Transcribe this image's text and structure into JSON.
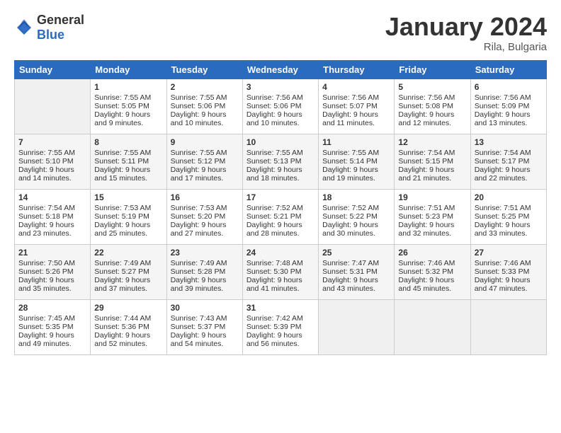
{
  "logo": {
    "text_general": "General",
    "text_blue": "Blue"
  },
  "title": "January 2024",
  "location": "Rila, Bulgaria",
  "days_header": [
    "Sunday",
    "Monday",
    "Tuesday",
    "Wednesday",
    "Thursday",
    "Friday",
    "Saturday"
  ],
  "weeks": [
    [
      {
        "num": "",
        "empty": true
      },
      {
        "num": "1",
        "sunrise": "Sunrise: 7:55 AM",
        "sunset": "Sunset: 5:05 PM",
        "daylight": "Daylight: 9 hours and 9 minutes."
      },
      {
        "num": "2",
        "sunrise": "Sunrise: 7:55 AM",
        "sunset": "Sunset: 5:06 PM",
        "daylight": "Daylight: 9 hours and 10 minutes."
      },
      {
        "num": "3",
        "sunrise": "Sunrise: 7:56 AM",
        "sunset": "Sunset: 5:06 PM",
        "daylight": "Daylight: 9 hours and 10 minutes."
      },
      {
        "num": "4",
        "sunrise": "Sunrise: 7:56 AM",
        "sunset": "Sunset: 5:07 PM",
        "daylight": "Daylight: 9 hours and 11 minutes."
      },
      {
        "num": "5",
        "sunrise": "Sunrise: 7:56 AM",
        "sunset": "Sunset: 5:08 PM",
        "daylight": "Daylight: 9 hours and 12 minutes."
      },
      {
        "num": "6",
        "sunrise": "Sunrise: 7:56 AM",
        "sunset": "Sunset: 5:09 PM",
        "daylight": "Daylight: 9 hours and 13 minutes."
      }
    ],
    [
      {
        "num": "7",
        "sunrise": "Sunrise: 7:55 AM",
        "sunset": "Sunset: 5:10 PM",
        "daylight": "Daylight: 9 hours and 14 minutes."
      },
      {
        "num": "8",
        "sunrise": "Sunrise: 7:55 AM",
        "sunset": "Sunset: 5:11 PM",
        "daylight": "Daylight: 9 hours and 15 minutes."
      },
      {
        "num": "9",
        "sunrise": "Sunrise: 7:55 AM",
        "sunset": "Sunset: 5:12 PM",
        "daylight": "Daylight: 9 hours and 17 minutes."
      },
      {
        "num": "10",
        "sunrise": "Sunrise: 7:55 AM",
        "sunset": "Sunset: 5:13 PM",
        "daylight": "Daylight: 9 hours and 18 minutes."
      },
      {
        "num": "11",
        "sunrise": "Sunrise: 7:55 AM",
        "sunset": "Sunset: 5:14 PM",
        "daylight": "Daylight: 9 hours and 19 minutes."
      },
      {
        "num": "12",
        "sunrise": "Sunrise: 7:54 AM",
        "sunset": "Sunset: 5:15 PM",
        "daylight": "Daylight: 9 hours and 21 minutes."
      },
      {
        "num": "13",
        "sunrise": "Sunrise: 7:54 AM",
        "sunset": "Sunset: 5:17 PM",
        "daylight": "Daylight: 9 hours and 22 minutes."
      }
    ],
    [
      {
        "num": "14",
        "sunrise": "Sunrise: 7:54 AM",
        "sunset": "Sunset: 5:18 PM",
        "daylight": "Daylight: 9 hours and 23 minutes."
      },
      {
        "num": "15",
        "sunrise": "Sunrise: 7:53 AM",
        "sunset": "Sunset: 5:19 PM",
        "daylight": "Daylight: 9 hours and 25 minutes."
      },
      {
        "num": "16",
        "sunrise": "Sunrise: 7:53 AM",
        "sunset": "Sunset: 5:20 PM",
        "daylight": "Daylight: 9 hours and 27 minutes."
      },
      {
        "num": "17",
        "sunrise": "Sunrise: 7:52 AM",
        "sunset": "Sunset: 5:21 PM",
        "daylight": "Daylight: 9 hours and 28 minutes."
      },
      {
        "num": "18",
        "sunrise": "Sunrise: 7:52 AM",
        "sunset": "Sunset: 5:22 PM",
        "daylight": "Daylight: 9 hours and 30 minutes."
      },
      {
        "num": "19",
        "sunrise": "Sunrise: 7:51 AM",
        "sunset": "Sunset: 5:23 PM",
        "daylight": "Daylight: 9 hours and 32 minutes."
      },
      {
        "num": "20",
        "sunrise": "Sunrise: 7:51 AM",
        "sunset": "Sunset: 5:25 PM",
        "daylight": "Daylight: 9 hours and 33 minutes."
      }
    ],
    [
      {
        "num": "21",
        "sunrise": "Sunrise: 7:50 AM",
        "sunset": "Sunset: 5:26 PM",
        "daylight": "Daylight: 9 hours and 35 minutes."
      },
      {
        "num": "22",
        "sunrise": "Sunrise: 7:49 AM",
        "sunset": "Sunset: 5:27 PM",
        "daylight": "Daylight: 9 hours and 37 minutes."
      },
      {
        "num": "23",
        "sunrise": "Sunrise: 7:49 AM",
        "sunset": "Sunset: 5:28 PM",
        "daylight": "Daylight: 9 hours and 39 minutes."
      },
      {
        "num": "24",
        "sunrise": "Sunrise: 7:48 AM",
        "sunset": "Sunset: 5:30 PM",
        "daylight": "Daylight: 9 hours and 41 minutes."
      },
      {
        "num": "25",
        "sunrise": "Sunrise: 7:47 AM",
        "sunset": "Sunset: 5:31 PM",
        "daylight": "Daylight: 9 hours and 43 minutes."
      },
      {
        "num": "26",
        "sunrise": "Sunrise: 7:46 AM",
        "sunset": "Sunset: 5:32 PM",
        "daylight": "Daylight: 9 hours and 45 minutes."
      },
      {
        "num": "27",
        "sunrise": "Sunrise: 7:46 AM",
        "sunset": "Sunset: 5:33 PM",
        "daylight": "Daylight: 9 hours and 47 minutes."
      }
    ],
    [
      {
        "num": "28",
        "sunrise": "Sunrise: 7:45 AM",
        "sunset": "Sunset: 5:35 PM",
        "daylight": "Daylight: 9 hours and 49 minutes."
      },
      {
        "num": "29",
        "sunrise": "Sunrise: 7:44 AM",
        "sunset": "Sunset: 5:36 PM",
        "daylight": "Daylight: 9 hours and 52 minutes."
      },
      {
        "num": "30",
        "sunrise": "Sunrise: 7:43 AM",
        "sunset": "Sunset: 5:37 PM",
        "daylight": "Daylight: 9 hours and 54 minutes."
      },
      {
        "num": "31",
        "sunrise": "Sunrise: 7:42 AM",
        "sunset": "Sunset: 5:39 PM",
        "daylight": "Daylight: 9 hours and 56 minutes."
      },
      {
        "num": "",
        "empty": true
      },
      {
        "num": "",
        "empty": true
      },
      {
        "num": "",
        "empty": true
      }
    ]
  ]
}
